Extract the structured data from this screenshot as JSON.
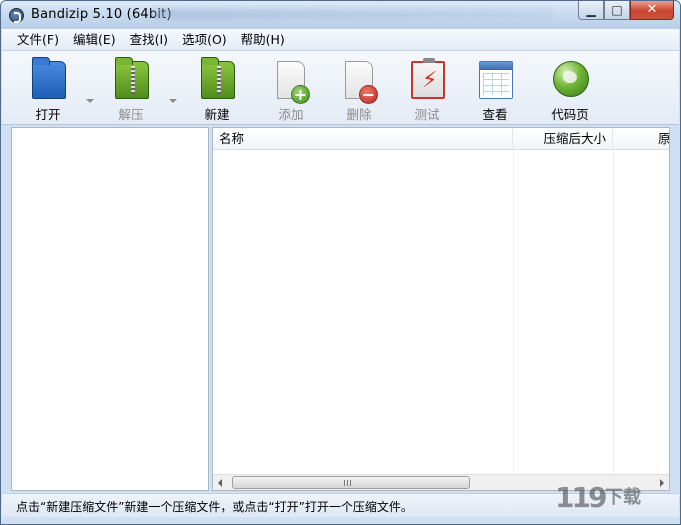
{
  "window": {
    "title": "Bandizip 5.10 (64bit)",
    "controls": {
      "minimize": "▁",
      "maximize": "□",
      "close": "✕"
    }
  },
  "menu": [
    "文件(F)",
    "编辑(E)",
    "查找(I)",
    "选项(O)",
    "帮助(H)"
  ],
  "toolbar": {
    "open": {
      "label": "打开",
      "icon": "folder-open-icon",
      "enabled": true,
      "has_dropdown": true
    },
    "extract": {
      "label": "解压",
      "icon": "extract-folder-icon",
      "enabled": false,
      "has_dropdown": true
    },
    "new": {
      "label": "新建",
      "icon": "new-archive-icon",
      "enabled": true
    },
    "add": {
      "label": "添加",
      "icon": "add-file-icon",
      "enabled": false
    },
    "delete": {
      "label": "删除",
      "icon": "delete-file-icon",
      "enabled": false
    },
    "test": {
      "label": "测试",
      "icon": "test-archive-icon",
      "enabled": false
    },
    "view": {
      "label": "查看",
      "icon": "view-layout-icon",
      "enabled": true
    },
    "codepage": {
      "label": "代码页",
      "icon": "globe-icon",
      "enabled": true
    }
  },
  "file_list": {
    "columns": [
      "名称",
      "压缩后大小",
      "原"
    ],
    "rows": []
  },
  "status": {
    "text": "点击“新建压缩文件”新建一个压缩文件，或点击“打开”打开一个压缩文件。"
  },
  "watermark": {
    "mark": "119",
    "text": "下载"
  },
  "colors": {
    "frame": "#cfe0f3",
    "close_button": "#c8442f",
    "accent": "#1d5fb8"
  }
}
